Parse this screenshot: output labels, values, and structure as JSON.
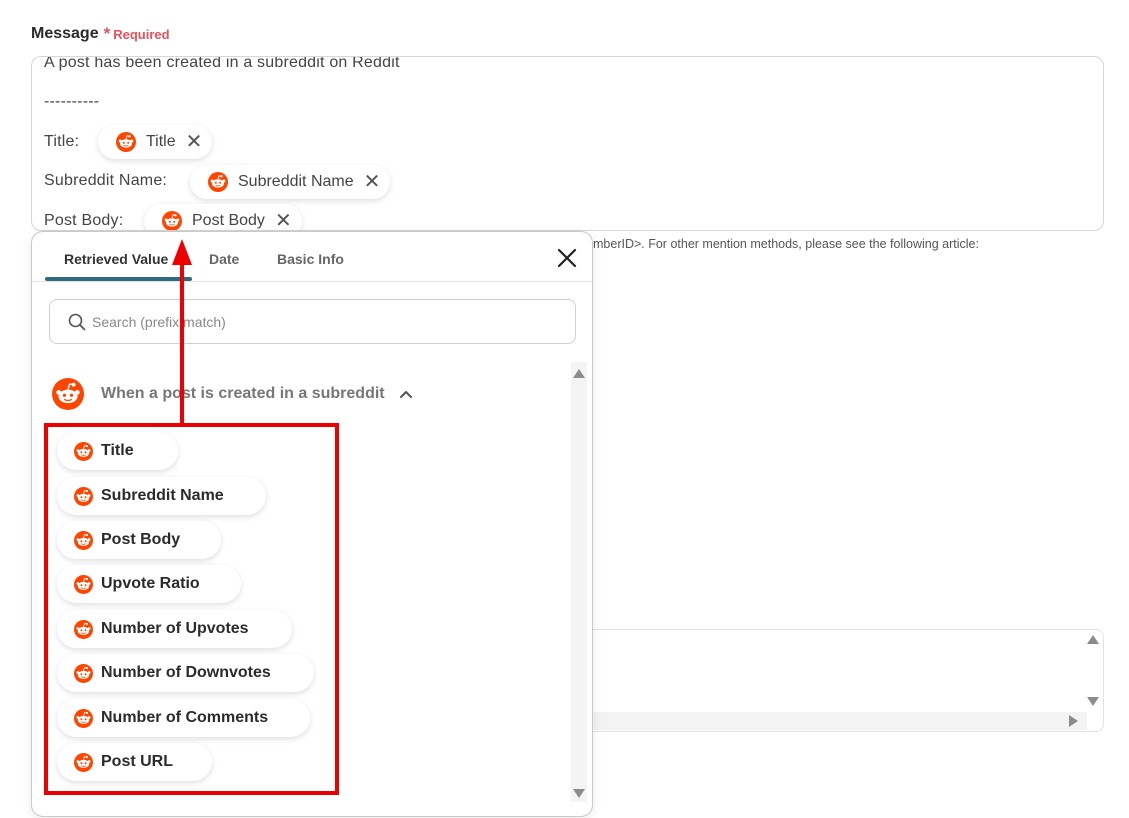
{
  "field": {
    "label": "Message",
    "required_mark": "*",
    "required_text": "Required"
  },
  "message": {
    "line1": "A post has been created in a subreddit on Reddit",
    "line2": "----------",
    "rows": [
      {
        "label": "Title:",
        "chip": "Title"
      },
      {
        "label": "Subreddit Name:",
        "chip": "Subreddit Name"
      },
      {
        "label": "Post Body:",
        "chip": "Post Body"
      }
    ]
  },
  "help_text": "mberID>. For other mention methods, please see the following article:",
  "background_text": "",
  "popup": {
    "tabs": [
      "Retrieved Value",
      "Date",
      "Basic Info"
    ],
    "active_tab": 0,
    "search_placeholder": "Search (prefix match)",
    "group_title": "When a post is created in a subreddit",
    "items": [
      "Title",
      "Subreddit Name",
      "Post Body",
      "Upvote Ratio",
      "Number of Upvotes",
      "Number of Downvotes",
      "Number of Comments",
      "Post URL"
    ]
  },
  "colors": {
    "reddit_orange": "#ff4500",
    "required_red": "#e8505b",
    "tab_underline": "#2d6b80",
    "annotation_red": "#ee0000"
  },
  "icons": {
    "app": "reddit-icon",
    "close": "close-icon",
    "search": "search-icon",
    "collapse": "chevron-up-icon"
  }
}
